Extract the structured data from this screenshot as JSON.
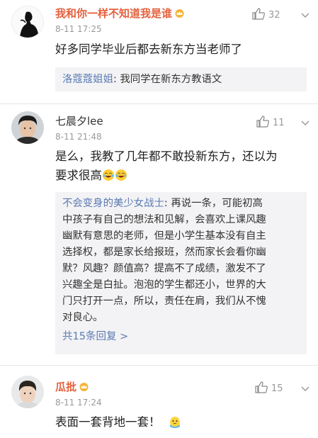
{
  "comments": [
    {
      "username": "我和你一样不知道我是谁",
      "time": "8-11 17:25",
      "likes": "32",
      "text": "好多同学毕业后都去新东方当老师了",
      "reply": {
        "author": "洛蔻蔻姐姐",
        "text": ": 我同学在新东方教语文"
      }
    },
    {
      "username": "七晨夕lee",
      "time": "8-11 21:48",
      "likes": "11",
      "text_lines": [
        "是么，我教了几年都不敢投新东方，还以为",
        "要求很高"
      ],
      "reply": {
        "author": "不会变身的美少女战士",
        "lines": [
          ": 再说一条，可能初高",
          "中孩子有自己的想法和见解，会喜欢上课风趣",
          "幽默有意思的老师，但是小学生基本没有自主",
          "选择权，都是家长给报班，然而家长会看你幽",
          "默？风趣？颜值高？提高不了成绩，激发不了",
          "兴趣全是白扯。泡泡的学生都还小，世界的大",
          "门只打开一点，所以，责任在肩，我们从不愧",
          "对良心。"
        ],
        "more": "共15条回复 >"
      }
    },
    {
      "username": "瓜批",
      "time": "8-11 17:24",
      "likes": "15",
      "text": "表面一套背地一套！"
    }
  ],
  "icons": {
    "like": "thumbs-up-icon",
    "more": "chevron-down-icon",
    "vip": "crown-badge-icon",
    "laugh": "laughing-emoji",
    "sweat": "sweat-emoji"
  },
  "colors": {
    "vip_name": "#e5603c",
    "link_blue": "#5b7ab2",
    "meta_gray": "#999999",
    "reply_bg": "#f3f3f5"
  }
}
